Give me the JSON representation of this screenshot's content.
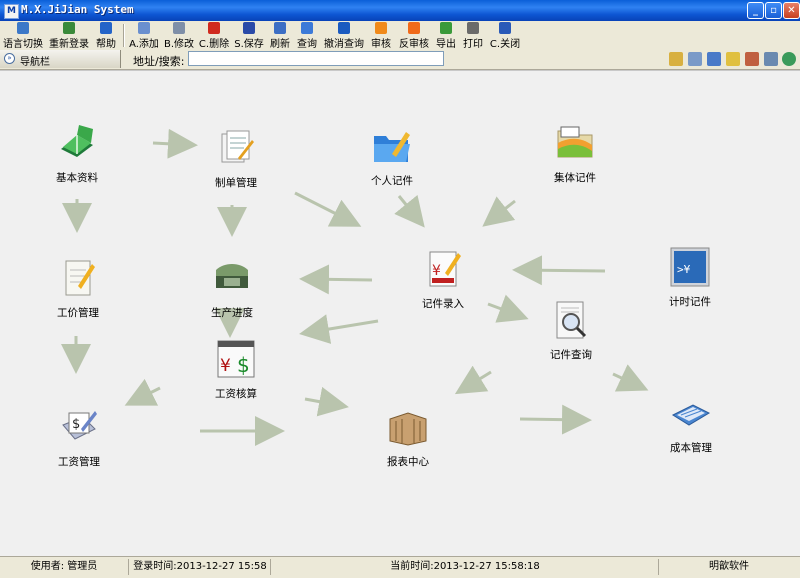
{
  "window": {
    "title": "M.X.JiJian System",
    "icon_letter": "M"
  },
  "toolbar": {
    "items": [
      {
        "label": "语言切换",
        "icon": "language-icon",
        "color": "#3b78c8"
      },
      {
        "label": "重新登录",
        "icon": "relogin-icon",
        "color": "#3a8a3a"
      },
      {
        "label": "帮助",
        "icon": "help-icon",
        "color": "#2464c8"
      },
      {
        "label": "A.添加",
        "icon": "add-icon",
        "color": "#6a8fcf"
      },
      {
        "label": "B.修改",
        "icon": "edit-icon",
        "color": "#7f8fa8"
      },
      {
        "label": "C.删除",
        "icon": "delete-icon",
        "color": "#d02a1e"
      },
      {
        "label": "S.保存",
        "icon": "save-icon",
        "color": "#2a4aa8"
      },
      {
        "label": "刷新",
        "icon": "refresh-icon",
        "color": "#3c6ec4"
      },
      {
        "label": "查询",
        "icon": "query-icon",
        "color": "#3c7ad8"
      },
      {
        "label": "撤消查询",
        "icon": "cancel-query-icon",
        "color": "#1a5ac0"
      },
      {
        "label": "审核",
        "icon": "audit-icon",
        "color": "#f08a1a"
      },
      {
        "label": "反审核",
        "icon": "unaudit-icon",
        "color": "#f06a1a"
      },
      {
        "label": "导出",
        "icon": "export-icon",
        "color": "#3a9a3a"
      },
      {
        "label": "打印",
        "icon": "print-icon",
        "color": "#6a6a6a"
      },
      {
        "label": "C.关闭",
        "icon": "close-app-icon",
        "color": "#2a5ab8"
      }
    ]
  },
  "addressbar": {
    "nav_label": "导航栏",
    "address_label": "地址/搜索:",
    "address_value": ""
  },
  "nodes": [
    {
      "id": "basic",
      "label": "基本资料",
      "icon": "book-icon"
    },
    {
      "id": "order",
      "label": "制单管理",
      "icon": "order-doc-icon"
    },
    {
      "id": "personal",
      "label": "个人记件",
      "icon": "personal-folder-icon"
    },
    {
      "id": "group",
      "label": "集体记件",
      "icon": "group-folder-icon"
    },
    {
      "id": "rate",
      "label": "工价管理",
      "icon": "rate-doc-icon"
    },
    {
      "id": "progress",
      "label": "生产进度",
      "icon": "phone-icon"
    },
    {
      "id": "entry",
      "label": "记件录入",
      "icon": "entry-doc-icon"
    },
    {
      "id": "timer",
      "label": "计时记件",
      "icon": "timer-screen-icon"
    },
    {
      "id": "calc",
      "label": "工资核算",
      "icon": "calc-money-icon"
    },
    {
      "id": "query",
      "label": "记件查询",
      "icon": "magnifier-doc-icon"
    },
    {
      "id": "wage",
      "label": "工资管理",
      "icon": "wage-icon"
    },
    {
      "id": "report",
      "label": "报表中心",
      "icon": "boxes-icon"
    },
    {
      "id": "cost",
      "label": "成本管理",
      "icon": "calendar-icon"
    }
  ],
  "status": {
    "user_label": "使用者:",
    "user": "管理员",
    "login_label": "登录时间:",
    "login_time": "2013-12-27 15:58",
    "now_label": "当前时间:",
    "now_time": "2013-12-27 15:58:18",
    "company": "明歆软件"
  },
  "colors": {
    "arrow": "#b9c4ad",
    "canvas": "#f0f0f0",
    "titlebar": "#0a5fd8"
  }
}
